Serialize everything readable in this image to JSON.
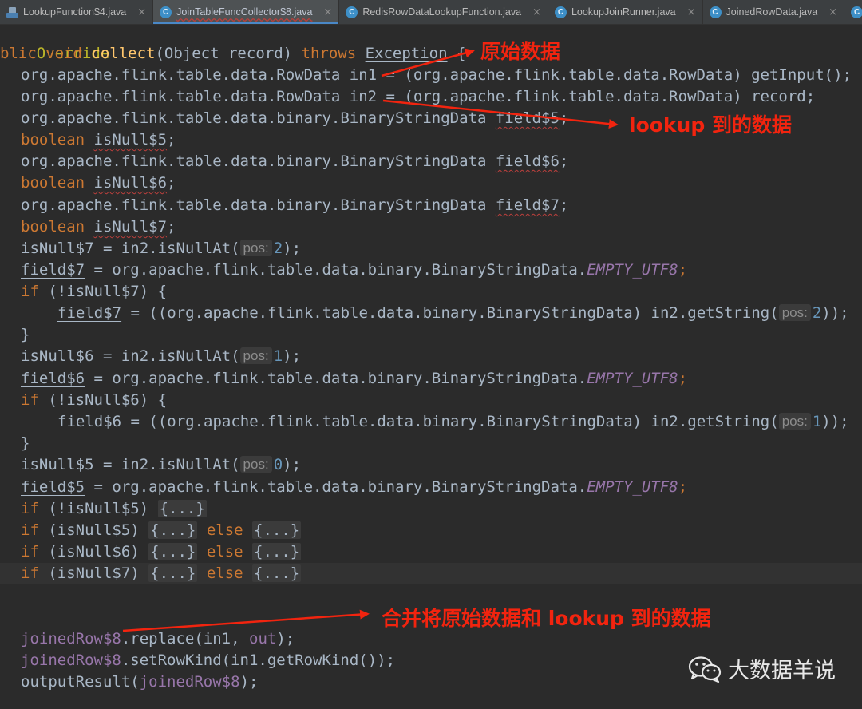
{
  "tabs": [
    {
      "label": "LookupFunction$4.java",
      "icon": "java-file-icon",
      "active": false
    },
    {
      "label": "JoinTableFuncCollector$8.java",
      "icon": "class-icon",
      "active": true
    },
    {
      "label": "RedisRowDataLookupFunction.java",
      "icon": "class-icon",
      "active": false
    },
    {
      "label": "LookupJoinRunner.java",
      "icon": "class-icon",
      "active": false
    },
    {
      "label": "JoinedRowData.java",
      "icon": "class-icon",
      "active": false
    },
    {
      "label": "C",
      "icon": "class-icon",
      "active": false
    }
  ],
  "tab_close_glyph": "×",
  "code": {
    "l1": "Override",
    "l2_a": "blic ",
    "l2_void": "void ",
    "l2_fn": "collect",
    "l2_b": "(Object record) ",
    "l2_throws": "throws ",
    "l2_exc": "Exception",
    "l2_c": " {",
    "l3": "org.apache.flink.table.data.RowData in1 = (org.apache.flink.table.data.RowData) getInput();",
    "l4": "org.apache.flink.table.data.RowData in2 = (org.apache.flink.table.data.RowData) record;",
    "l5_a": "org.apache.flink.table.data.binary.BinaryStringData ",
    "l5_f": "field$5",
    "l5_b": ";",
    "l6_kw": "boolean ",
    "l6_f": "isNull$5",
    "l6_b": ";",
    "l7_a": "org.apache.flink.table.data.binary.BinaryStringData ",
    "l7_f": "field$6",
    "l7_b": ";",
    "l8_kw": "boolean ",
    "l8_f": "isNull$6",
    "l8_b": ";",
    "l9_a": "org.apache.flink.table.data.binary.BinaryStringData ",
    "l9_f": "field$7",
    "l9_b": ";",
    "l10_kw": "boolean ",
    "l10_f": "isNull$7",
    "l10_b": ";",
    "l11_a": "isNull$7 = in2.isNullAt(",
    "l11_hint": "pos:",
    "l11_n": "2",
    "l11_b": ");",
    "l12_f": "field$7",
    "l12_a": " = org.apache.flink.table.data.binary.BinaryStringData.",
    "l12_c": "EMPTY_UTF8",
    "l12_b": ";",
    "l13_kw": "if ",
    "l13_a": "(!isNull$7) {",
    "l14_f": "field$7",
    "l14_a": " = ((org.apache.flink.table.data.binary.BinaryStringData) in2.getString(",
    "l14_hint": "pos:",
    "l14_n": "2",
    "l14_b": "));",
    "l15": "}",
    "l16_a": "isNull$6 = in2.isNullAt(",
    "l16_hint": "pos:",
    "l16_n": "1",
    "l16_b": ");",
    "l17_f": "field$6",
    "l17_a": " = org.apache.flink.table.data.binary.BinaryStringData.",
    "l17_c": "EMPTY_UTF8",
    "l17_b": ";",
    "l18_kw": "if ",
    "l18_a": "(!isNull$6) {",
    "l19_f": "field$6",
    "l19_a": " = ((org.apache.flink.table.data.binary.BinaryStringData) in2.getString(",
    "l19_hint": "pos:",
    "l19_n": "1",
    "l19_b": "));",
    "l20": "}",
    "l21_a": "isNull$5 = in2.isNullAt(",
    "l21_hint": "pos:",
    "l21_n": "0",
    "l21_b": ");",
    "l22_f": "field$5",
    "l22_a": " = org.apache.flink.table.data.binary.BinaryStringData.",
    "l22_c": "EMPTY_UTF8",
    "l22_b": ";",
    "l23_kw": "if ",
    "l23_a": "(!isNull$5) ",
    "l23_fold": "{...}",
    "l24_kw": "if ",
    "l24_a": "(isNull$5) ",
    "l24_fold1": "{...}",
    "l24_else": " else ",
    "l24_fold2": "{...}",
    "l25_kw": "if ",
    "l25_a": "(isNull$6) ",
    "l25_fold1": "{...}",
    "l25_else": " else ",
    "l25_fold2": "{...}",
    "l26_kw": "if ",
    "l26_a": "(isNull$7) ",
    "l26_fold1": "{...}",
    "l26_else": " else ",
    "l26_fold2": "{...}",
    "l29_f": "joinedRow$8",
    "l29_a": ".replace(in1, ",
    "l29_out": "out",
    "l29_b": ");",
    "l30_f": "joinedRow$8",
    "l30_a": ".setRowKind(in1.getRowKind());",
    "l31_a": "outputResult(",
    "l31_f": "joinedRow$8",
    "l31_b": ");"
  },
  "annotations": {
    "original_data": "原始数据",
    "lookup_data": "lookup 到的数据",
    "merge_data": "合并将原始数据和 lookup 到的数据"
  },
  "watermark": {
    "text": "大数据羊说",
    "icon": "wechat-icon"
  },
  "colors": {
    "background": "#2b2b2b",
    "keyword": "#cc7832",
    "method": "#ffc66d",
    "number": "#6897bb",
    "constant": "#9876aa",
    "text": "#a9b7c6",
    "annotation_red": "#f2240f"
  }
}
